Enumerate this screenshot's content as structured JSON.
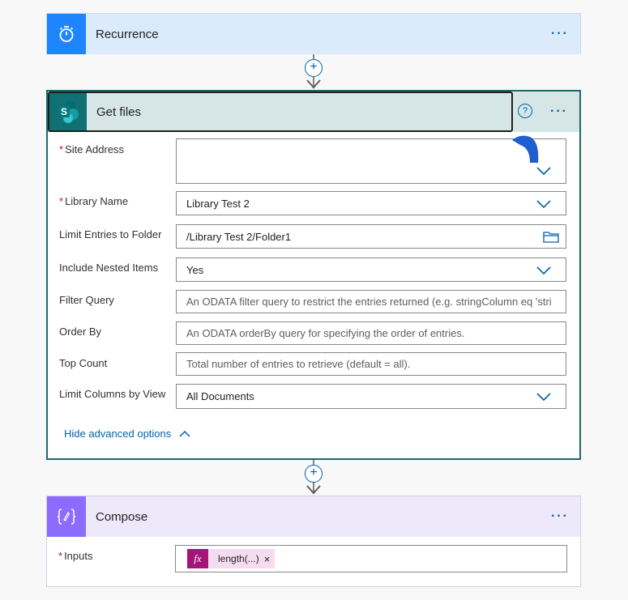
{
  "recurrence": {
    "title": "Recurrence",
    "icon": "stopwatch-icon",
    "menu": "···"
  },
  "get_files": {
    "title": "Get files",
    "icon": "sharepoint-icon",
    "icon_letter": "S",
    "help": "?",
    "menu": "···",
    "fields": [
      {
        "label": "Site Address",
        "required": true,
        "value": "",
        "placeholder": ""
      },
      {
        "label": "Library Name",
        "required": true,
        "value": "Library Test 2"
      },
      {
        "label": "Limit Entries to Folder",
        "required": false,
        "value": "/Library Test 2/Folder1"
      },
      {
        "label": "Include Nested Items",
        "required": false,
        "value": "Yes"
      },
      {
        "label": "Filter Query",
        "required": false,
        "placeholder": "An ODATA filter query to restrict the entries returned (e.g. stringColumn eq 'stri"
      },
      {
        "label": "Order By",
        "required": false,
        "placeholder": "An ODATA orderBy query for specifying the order of entries."
      },
      {
        "label": "Top Count",
        "required": false,
        "placeholder": "Total number of entries to retrieve (default = all)."
      },
      {
        "label": "Limit Columns by View",
        "required": false,
        "value": "All Documents"
      }
    ],
    "advanced_link": "Hide advanced options"
  },
  "compose": {
    "title": "Compose",
    "icon": "braces-icon",
    "menu": "···",
    "inputs_label": "Inputs",
    "token": {
      "fx": "fx",
      "label": "length(...)",
      "remove": "×"
    }
  },
  "colors": {
    "recurrence_accent": "#1f85ff",
    "sharepoint_accent": "#0f7173",
    "compose_accent": "#8c6cff",
    "link": "#0062ad",
    "required": "#c50f1f"
  }
}
